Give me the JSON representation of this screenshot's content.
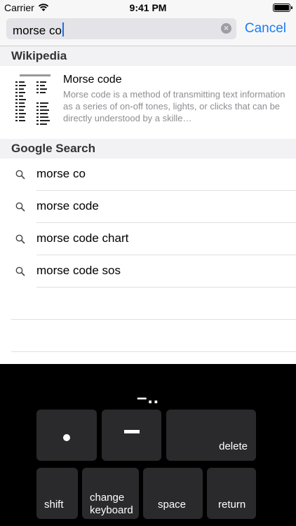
{
  "status_bar": {
    "carrier": "Carrier",
    "time": "9:41 PM"
  },
  "search": {
    "query": "morse co",
    "cancel_label": "Cancel"
  },
  "wikipedia": {
    "section_title": "Wikipedia",
    "result": {
      "title": "Morse code",
      "description": "Morse code is a method of transmitting text information as a series of on-off tones, lights, or clicks that can be directly understood by a skille…"
    }
  },
  "google": {
    "section_title": "Google Search",
    "suggestions": [
      "morse co",
      "morse code",
      "morse code chart",
      "morse code sos"
    ]
  },
  "keyboard": {
    "preview": "–..",
    "dot_key": "dot",
    "dash_key": "dash",
    "delete_label": "delete",
    "shift_label": "shift",
    "change_keyboard_label": "change\nkeyboard",
    "space_label": "space",
    "return_label": "return"
  },
  "colors": {
    "accent": "#1a7cf5",
    "keyboard_bg": "#000000",
    "key_bg": "#2a2a2c"
  }
}
